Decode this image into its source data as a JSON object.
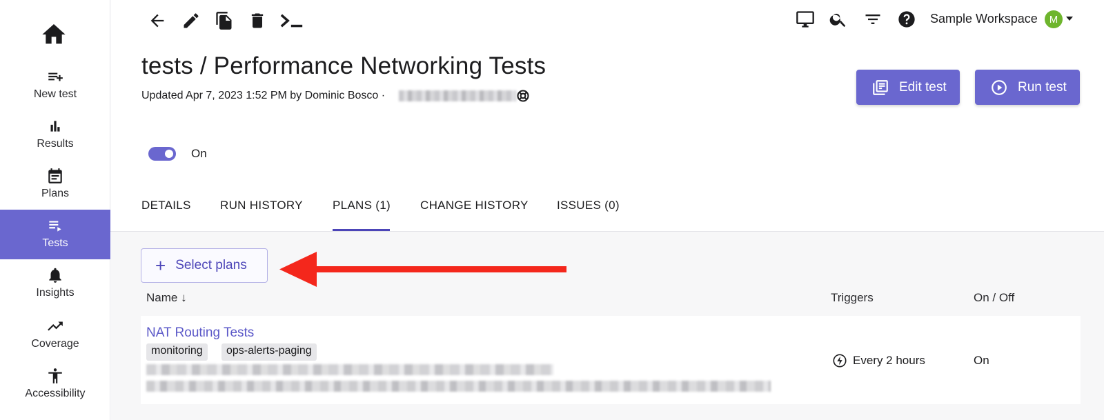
{
  "sidebar": {
    "home_icon": "home-icon",
    "items": [
      {
        "label": "New test",
        "icon": "playlist-add-icon",
        "active": false
      },
      {
        "label": "Results",
        "icon": "bar-chart-icon",
        "active": false
      },
      {
        "label": "Plans",
        "icon": "calendar-icon",
        "active": false
      },
      {
        "label": "Tests",
        "icon": "playlist-play-icon",
        "active": true
      },
      {
        "label": "Insights",
        "icon": "bell-icon",
        "active": false
      },
      {
        "label": "Coverage",
        "icon": "trending-up-icon",
        "active": false
      },
      {
        "label": "Accessibility",
        "icon": "accessibility-icon",
        "active": false
      }
    ]
  },
  "toolbar": {
    "icons": [
      "back-arrow-icon",
      "pencil-icon",
      "copy-icon",
      "trash-icon",
      "terminal-icon"
    ],
    "right_icons": [
      "monitor-icon",
      "search-icon",
      "filter-icon",
      "help-icon"
    ],
    "workspace_name": "Sample Workspace",
    "avatar_initial": "M"
  },
  "header": {
    "title": "tests / Performance Networking Tests",
    "updated": "Updated Apr 7, 2023 1:52 PM by Dominic Bosco ·",
    "edit_button": "Edit test",
    "run_button": "Run test"
  },
  "toggle": {
    "label": "On",
    "state": true
  },
  "tabs": [
    {
      "label": "DETAILS",
      "active": false
    },
    {
      "label": "RUN HISTORY",
      "active": false
    },
    {
      "label": "PLANS (1)",
      "active": true
    },
    {
      "label": "CHANGE HISTORY",
      "active": false
    },
    {
      "label": "ISSUES (0)",
      "active": false
    }
  ],
  "plans": {
    "select_button": "Select plans",
    "columns": {
      "name": "Name ↓",
      "triggers": "Triggers",
      "on_off": "On / Off"
    },
    "rows": [
      {
        "name": "NAT Routing Tests",
        "tags": [
          "monitoring",
          "ops-alerts-paging"
        ],
        "trigger": "Every 2 hours",
        "status": "On"
      }
    ]
  },
  "colors": {
    "accent": "#6a67cf",
    "link": "#5b58c8",
    "annotation_arrow": "#f4271c",
    "avatar": "#6eb52d"
  }
}
